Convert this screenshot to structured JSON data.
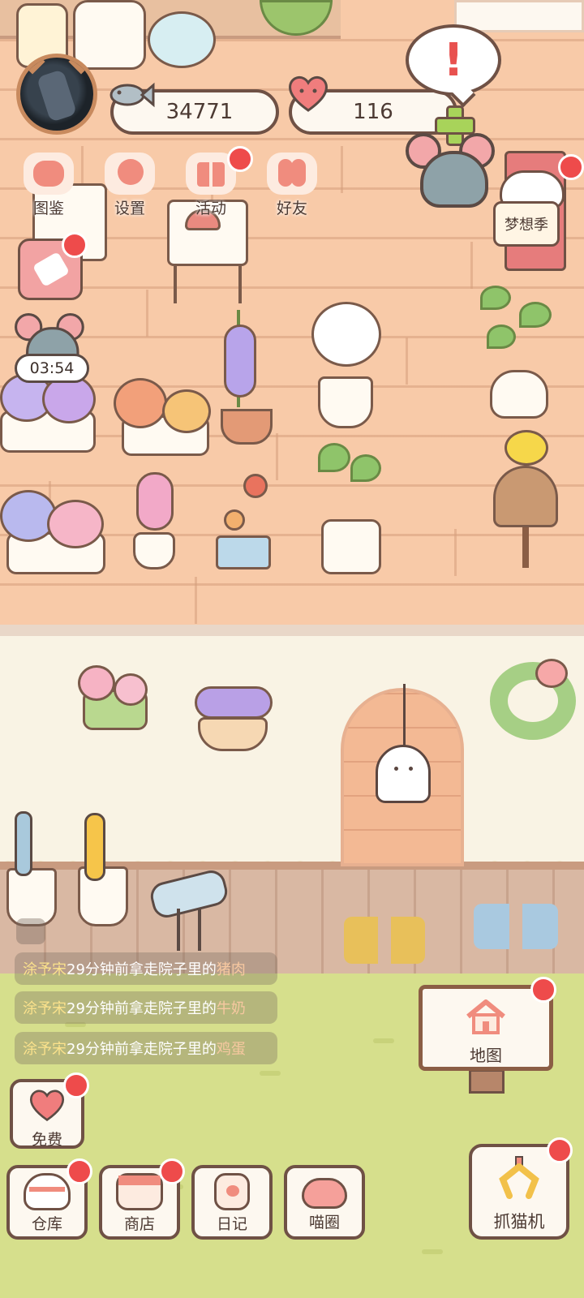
{
  "hud": {
    "coins": "34771",
    "hearts": "116",
    "alert": "!"
  },
  "menu": {
    "items": [
      {
        "label": "图鉴"
      },
      {
        "label": "设置"
      },
      {
        "label": "活动"
      },
      {
        "label": "好友"
      }
    ]
  },
  "season": {
    "label": "梦想季"
  },
  "timer": {
    "value": "03:54"
  },
  "feed": [
    {
      "who": "涂予宋",
      "text": "29分钟前拿走院子里的",
      "item": "猪肉"
    },
    {
      "who": "涂予宋",
      "text": "29分钟前拿走院子里的",
      "item": "牛奶"
    },
    {
      "who": "涂予宋",
      "text": "29分钟前拿走院子里的",
      "item": "鸡蛋"
    }
  ],
  "free": {
    "label": "免费"
  },
  "map": {
    "label": "地图"
  },
  "bottom": {
    "warehouse": "仓库",
    "shop": "商店",
    "diary": "日记",
    "circle": "喵圈",
    "claw": "抓猫机"
  },
  "colors": {
    "badge": "#ee4b4b",
    "outline": "#6f5145",
    "wall": "#f8caa8",
    "grass": "#d6df8c",
    "plus": "#a8d35a"
  }
}
